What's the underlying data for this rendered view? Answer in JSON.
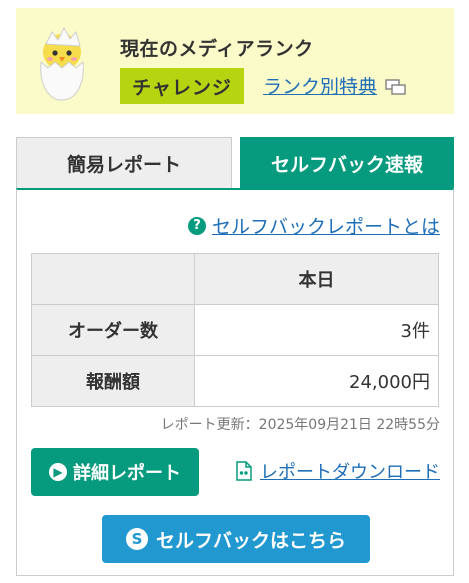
{
  "rank": {
    "title": "現在のメディアランク",
    "badge": "チャレンジ",
    "link_label": "ランク別特典"
  },
  "tabs": [
    {
      "label": "簡易レポート",
      "active": false
    },
    {
      "label": "セルフバック速報",
      "active": true
    }
  ],
  "help_link": "セルフバックレポートとは",
  "table": {
    "header": [
      "",
      "本日"
    ],
    "rows": [
      {
        "label": "オーダー数",
        "value": "3件"
      },
      {
        "label": "報酬額",
        "value": "24,000円"
      }
    ]
  },
  "updated": "レポート更新：2025年09月21日 22時55分",
  "buttons": {
    "detail": "詳細レポート",
    "download": "レポートダウンロード",
    "selfback": "セルフバックはこちら"
  },
  "colors": {
    "accent_green": "#069b7e",
    "badge_lime": "#b6d40f",
    "banner_yellow": "#fbfbc9",
    "link_blue": "#1e6eb8",
    "button_blue": "#2198d0"
  }
}
